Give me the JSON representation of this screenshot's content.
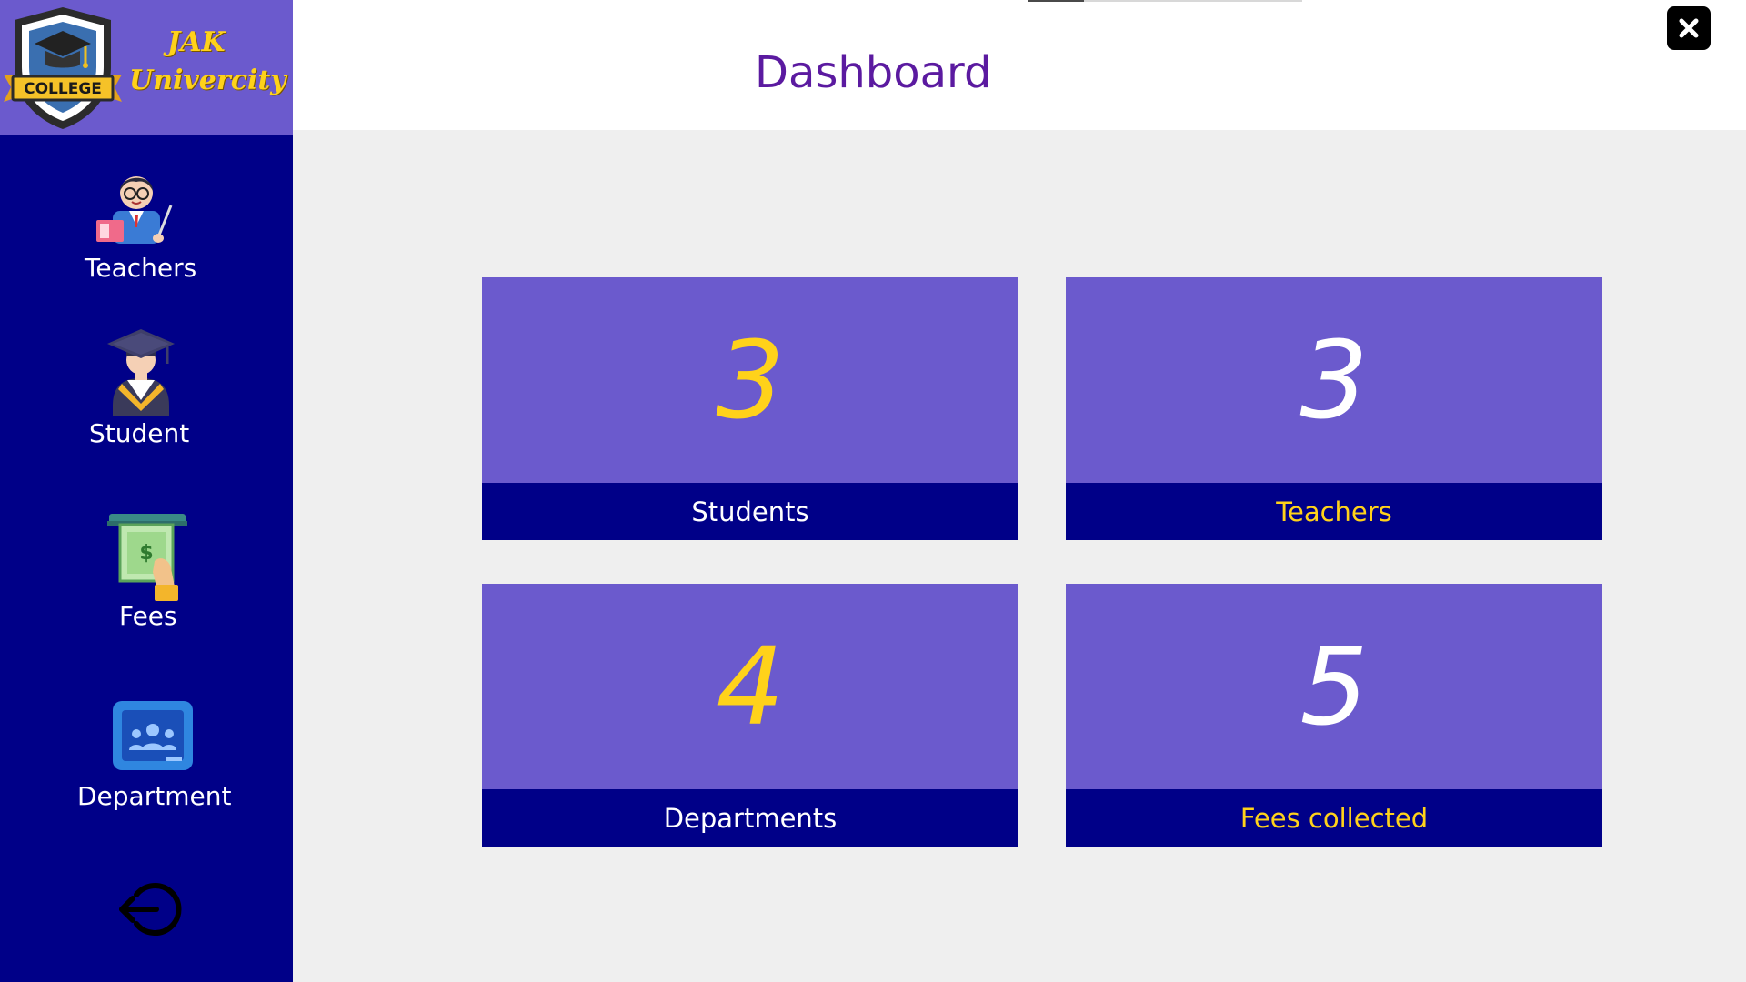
{
  "brand": {
    "logo_text": "COLLEGE",
    "name_line1": "JAK",
    "name_line2": "Univercity"
  },
  "sidebar": {
    "items": [
      {
        "label": "Teachers",
        "icon": "teacher-icon"
      },
      {
        "label": "Student",
        "icon": "graduate-icon"
      },
      {
        "label": "Fees",
        "icon": "cash-icon"
      },
      {
        "label": "Department",
        "icon": "department-icon"
      }
    ],
    "logout_icon": "logout-icon"
  },
  "header": {
    "title": "Dashboard",
    "close_icon": "close-icon"
  },
  "cards": [
    {
      "value": "3",
      "label": "Students"
    },
    {
      "value": "3",
      "label": "Teachers"
    },
    {
      "value": "4",
      "label": "Departments"
    },
    {
      "value": "5",
      "label": "Fees collected"
    }
  ],
  "colors": {
    "sidebar": "#000088",
    "accent": "#6b5acd",
    "highlight": "#ffd21a",
    "title": "#5b1aa0"
  }
}
